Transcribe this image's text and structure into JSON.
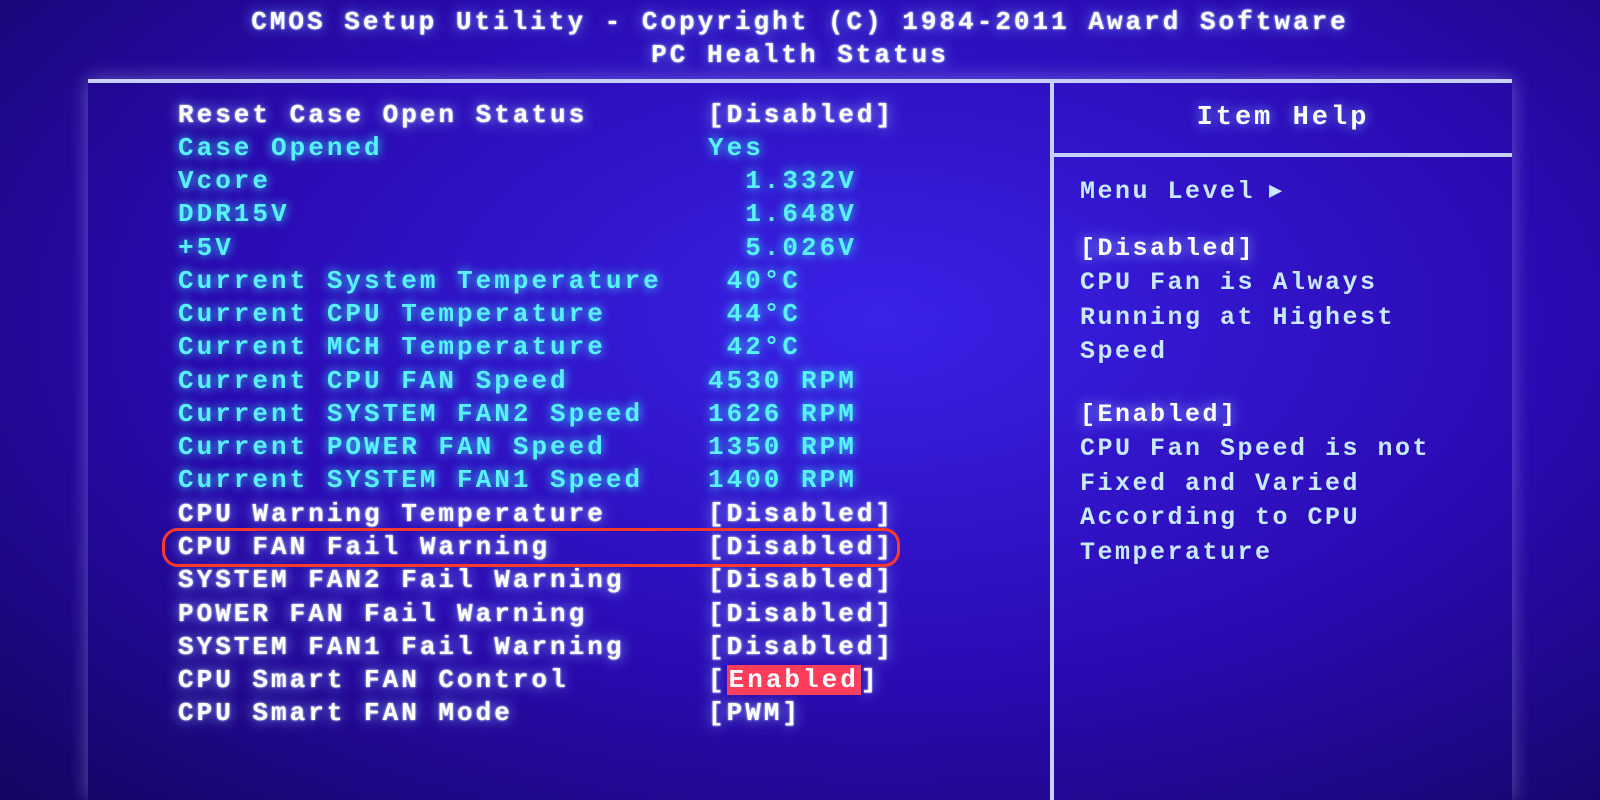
{
  "header": {
    "title1": "CMOS Setup Utility - Copyright (C) 1984-2011 Award Software",
    "title2": "PC Health Status"
  },
  "main": {
    "rows": [
      {
        "label": "Reset Case Open Status",
        "value": "[Disabled]",
        "color": "white",
        "interact": true
      },
      {
        "label": "Case Opened",
        "value": "Yes",
        "color": "cyan",
        "interact": false
      },
      {
        "label": "Vcore",
        "value": "  1.332V",
        "color": "cyan",
        "interact": false
      },
      {
        "label": "DDR15V",
        "value": "  1.648V",
        "color": "cyan",
        "interact": false
      },
      {
        "label": "+5V",
        "value": "  5.026V",
        "color": "cyan",
        "interact": false
      },
      {
        "label": "Current System Temperature",
        "value": " 40°C",
        "color": "cyan",
        "interact": false
      },
      {
        "label": "Current CPU Temperature",
        "value": " 44°C",
        "color": "cyan",
        "interact": false
      },
      {
        "label": "Current MCH Temperature",
        "value": " 42°C",
        "color": "cyan",
        "interact": false
      },
      {
        "label": "Current CPU FAN Speed",
        "value": "4530 RPM",
        "color": "cyan",
        "interact": false
      },
      {
        "label": "Current SYSTEM FAN2 Speed",
        "value": "1626 RPM",
        "color": "cyan",
        "interact": false
      },
      {
        "label": "Current POWER FAN Speed",
        "value": "1350 RPM",
        "color": "cyan",
        "interact": false
      },
      {
        "label": "Current SYSTEM FAN1 Speed",
        "value": "1400 RPM",
        "color": "cyan",
        "interact": false
      },
      {
        "label": "CPU Warning Temperature",
        "value": "[Disabled]",
        "color": "white",
        "interact": true
      },
      {
        "label": "CPU FAN Fail Warning",
        "value": "[Disabled]",
        "color": "white",
        "interact": true,
        "circled": true
      },
      {
        "label": "SYSTEM FAN2 Fail Warning",
        "value": "[Disabled]",
        "color": "white",
        "interact": true
      },
      {
        "label": "POWER FAN Fail Warning",
        "value": "[Disabled]",
        "color": "white",
        "interact": true
      },
      {
        "label": "SYSTEM FAN1 Fail Warning",
        "value": "[Disabled]",
        "color": "white",
        "interact": true
      },
      {
        "label": "CPU Smart FAN Control",
        "value": "[Enabled]",
        "color": "white",
        "interact": true,
        "selected": true
      },
      {
        "label": "CPU Smart FAN Mode",
        "value": "[PWM]",
        "color": "white",
        "interact": true
      }
    ]
  },
  "help": {
    "title": "Item Help",
    "menu_level_label": "Menu Level",
    "disabled_key": "[Disabled]",
    "disabled_text": "CPU Fan is Always Running at Highest Speed",
    "enabled_key": "[Enabled]",
    "enabled_text": "CPU Fan Speed is not Fixed and Varied According to CPU Temperature"
  }
}
